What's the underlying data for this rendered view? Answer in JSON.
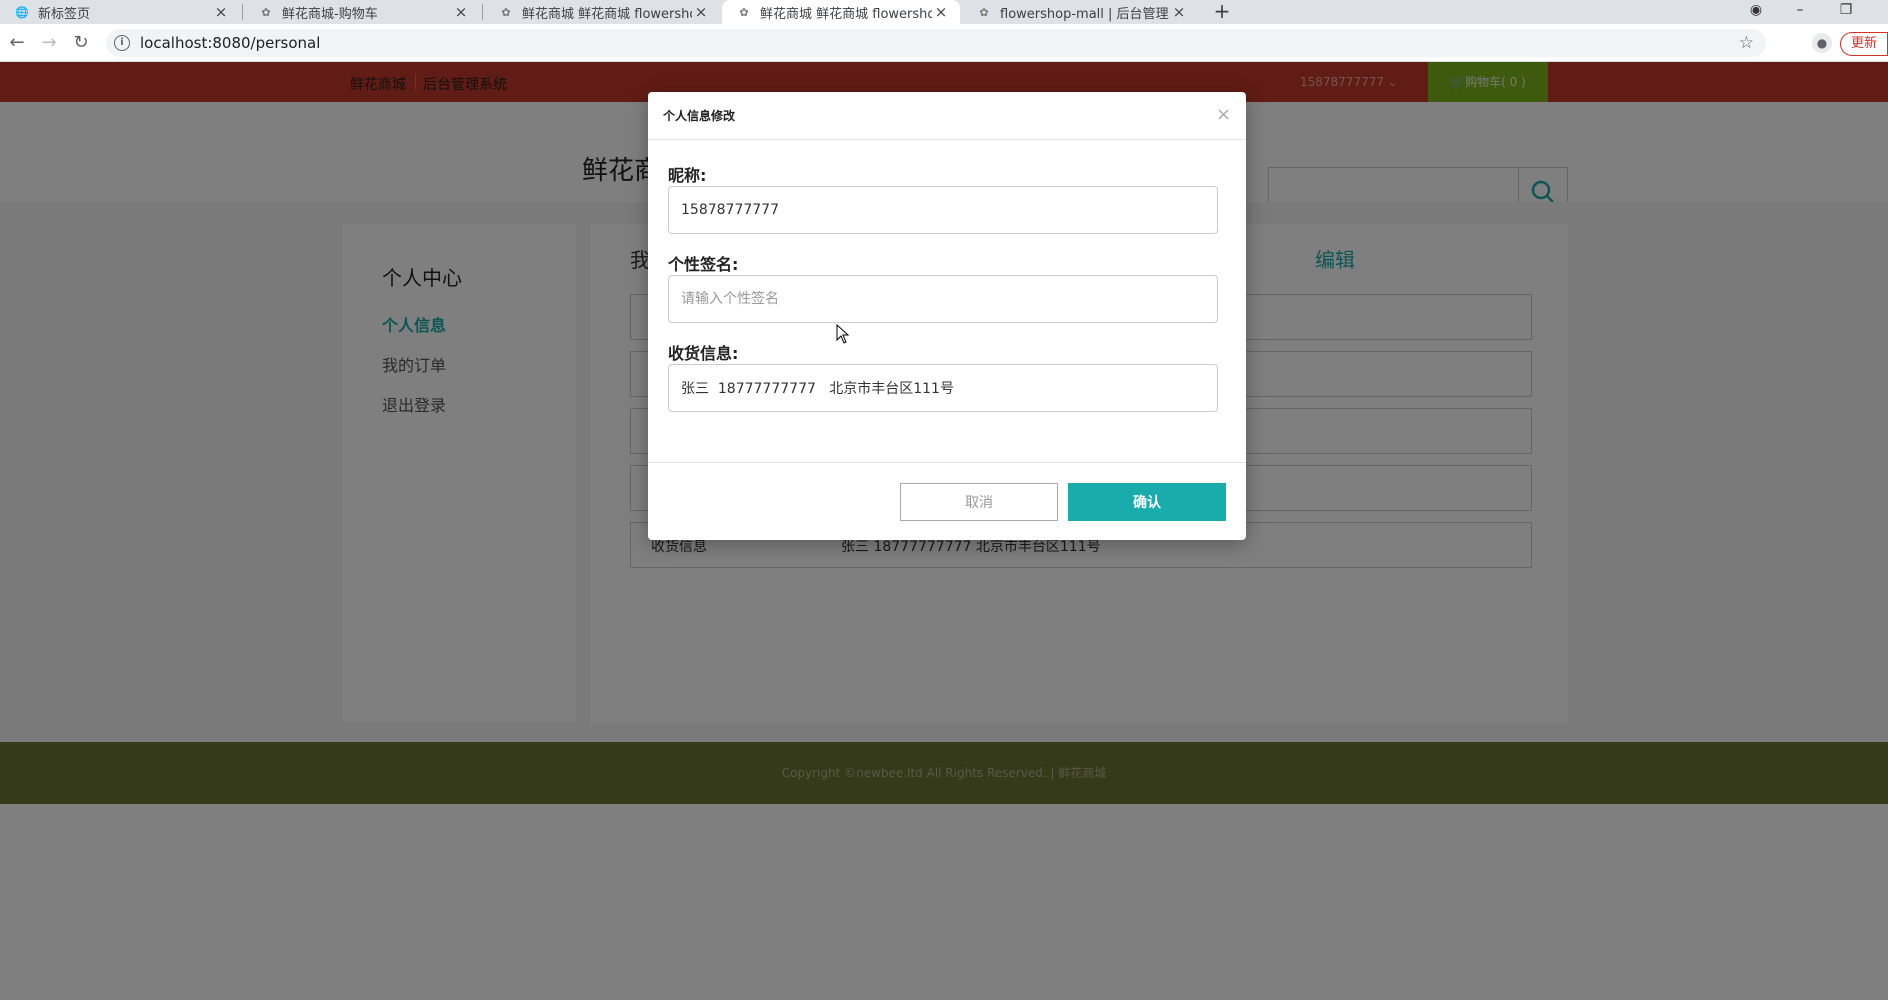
{
  "browser": {
    "tabs": [
      {
        "title": "新标签页",
        "active": false
      },
      {
        "title": "鲜花商城-购物车",
        "active": false
      },
      {
        "title": "鲜花商城 鲜花商城 flowershop",
        "active": false
      },
      {
        "title": "鲜花商城 鲜花商城 flowershop",
        "active": true
      },
      {
        "title": "flowershop-mall | 后台管理系统",
        "active": false
      }
    ],
    "url": "localhost:8080/personal",
    "update_label": "更新"
  },
  "topnav": {
    "brand": "鲜花商城",
    "admin": "后台管理系统",
    "user": "15878777777",
    "cart": "购物车( 0 )"
  },
  "header": {
    "logo": "鲜花商"
  },
  "sidebar": {
    "heading": "个人中心",
    "items": [
      {
        "label": "个人信息",
        "active": true
      },
      {
        "label": "我的订单",
        "active": false
      },
      {
        "label": "退出登录",
        "active": false
      }
    ]
  },
  "main": {
    "title": "我",
    "edit_label": "编辑",
    "rows": [
      {
        "key": "",
        "value": ""
      },
      {
        "key": "",
        "value": ""
      },
      {
        "key": "",
        "value": ""
      },
      {
        "key": "",
        "value": ""
      },
      {
        "key": "收货信息",
        "value": "张三 18777777777 北京市丰台区111号"
      }
    ]
  },
  "footer": {
    "copyright": "Copyright ©newbee.ltd All Rights Reserved.  |  鲜花商城"
  },
  "modal": {
    "title": "个人信息修改",
    "nickname_label": "昵称:",
    "nickname_value": "15878777777",
    "signature_label": "个性签名:",
    "signature_placeholder": "请输入个性签名",
    "signature_value": "",
    "address_label": "收货信息:",
    "address_value": "张三  18777777777   北京市丰台区111号",
    "cancel_label": "取消",
    "confirm_label": "确认"
  },
  "colors": {
    "topnav": "#c0392b",
    "cart": "#7cb518",
    "accent": "#1aacac",
    "footer": "#6b7436"
  }
}
